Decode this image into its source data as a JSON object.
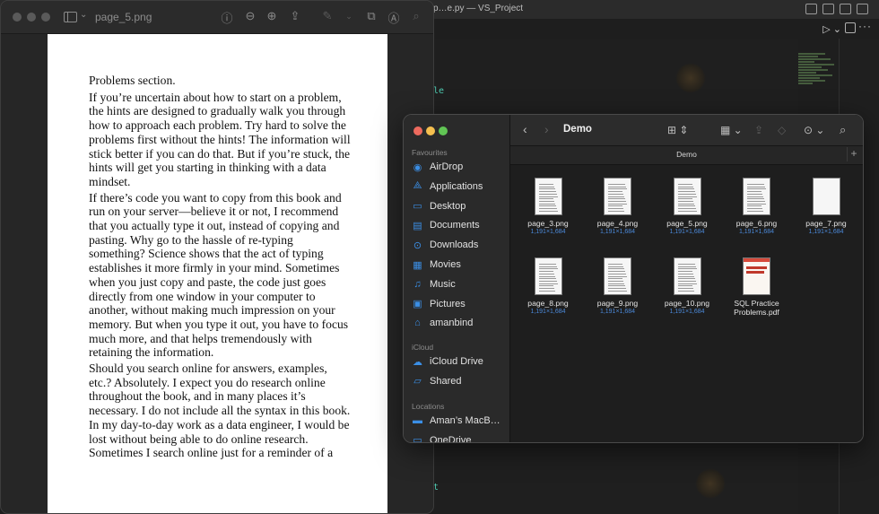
{
  "vscode": {
    "title": "p…e.py — VS_Project",
    "code_fragment_1": "le",
    "code_fragment_2": "t"
  },
  "preview": {
    "title": "page_5.png",
    "chevron": "⌄",
    "icons": [
      "info-icon",
      "zoom-out-icon",
      "zoom-in-icon",
      "share-icon",
      "markup-icon",
      "rotate-icon",
      "annotate-icon",
      "search-icon"
    ],
    "paragraphs": [
      "Problems section.",
      "If you’re uncertain about how to start on a problem, the hints are designed to gradually walk you through how to approach each problem. Try hard to solve the problems first without the hints! The information will stick better if you can do that. But if you’re stuck, the hints will get you starting in thinking with a data mindset.",
      "If there’s code you want to copy from this book and run on your server—believe it or not, I recommend that you actually type it out, instead of copying and pasting. Why go to the hassle of re-typing something? Science shows that the act of typing establishes it more firmly in your mind. Sometimes when you just copy and paste, the code just goes directly from one window in your computer to another, without making much impression on your memory. But when you type it out, you have to focus much more, and that helps tremendously with retaining the information.",
      "Should you search online for answers, examples, etc.? Absolutely. I expect you do research online throughout the book, and in many places it’s necessary. I do not include all the syntax in this book. In my day-to-day work as a data engineer, I would be lost without being able to do online research. Sometimes I search online just for a reminder of a"
    ]
  },
  "finder": {
    "title": "Demo",
    "path": "Demo",
    "sections": {
      "favourites": "Favourites",
      "icloud": "iCloud",
      "locations": "Locations"
    },
    "favourites": [
      {
        "label": "AirDrop",
        "icon": "airdrop-icon",
        "glyph": "◉"
      },
      {
        "label": "Applications",
        "icon": "applications-icon",
        "glyph": "⟁"
      },
      {
        "label": "Desktop",
        "icon": "desktop-icon",
        "glyph": "▭"
      },
      {
        "label": "Documents",
        "icon": "documents-icon",
        "glyph": "▤"
      },
      {
        "label": "Downloads",
        "icon": "downloads-icon",
        "glyph": "⊙"
      },
      {
        "label": "Movies",
        "icon": "movies-icon",
        "glyph": "▦"
      },
      {
        "label": "Music",
        "icon": "music-icon",
        "glyph": "♫"
      },
      {
        "label": "Pictures",
        "icon": "pictures-icon",
        "glyph": "▣"
      },
      {
        "label": "amanbind",
        "icon": "home-icon",
        "glyph": "⌂"
      }
    ],
    "icloud": [
      {
        "label": "iCloud Drive",
        "icon": "icloud-icon",
        "glyph": "☁"
      },
      {
        "label": "Shared",
        "icon": "shared-folder-icon",
        "glyph": "▱"
      }
    ],
    "locations": [
      {
        "label": "Aman’s MacB…",
        "icon": "laptop-icon",
        "glyph": "▬"
      },
      {
        "label": "OneDrive",
        "icon": "drive-icon",
        "glyph": "▭"
      }
    ],
    "files": [
      {
        "name": "page_3.png",
        "dims": "1,191×1,684",
        "kind": "page"
      },
      {
        "name": "page_4.png",
        "dims": "1,191×1,684",
        "kind": "page"
      },
      {
        "name": "page_5.png",
        "dims": "1,191×1,684",
        "kind": "page"
      },
      {
        "name": "page_6.png",
        "dims": "1,191×1,684",
        "kind": "page"
      },
      {
        "name": "page_7.png",
        "dims": "1,191×1,684",
        "kind": "blank"
      },
      {
        "name": "page_8.png",
        "dims": "1,191×1,684",
        "kind": "page"
      },
      {
        "name": "page_9.png",
        "dims": "1,191×1,684",
        "kind": "page"
      },
      {
        "name": "page_10.png",
        "dims": "1,191×1,684",
        "kind": "page"
      },
      {
        "name": "SQL Practice Problems.pdf",
        "dims": "",
        "kind": "pdf"
      }
    ]
  }
}
